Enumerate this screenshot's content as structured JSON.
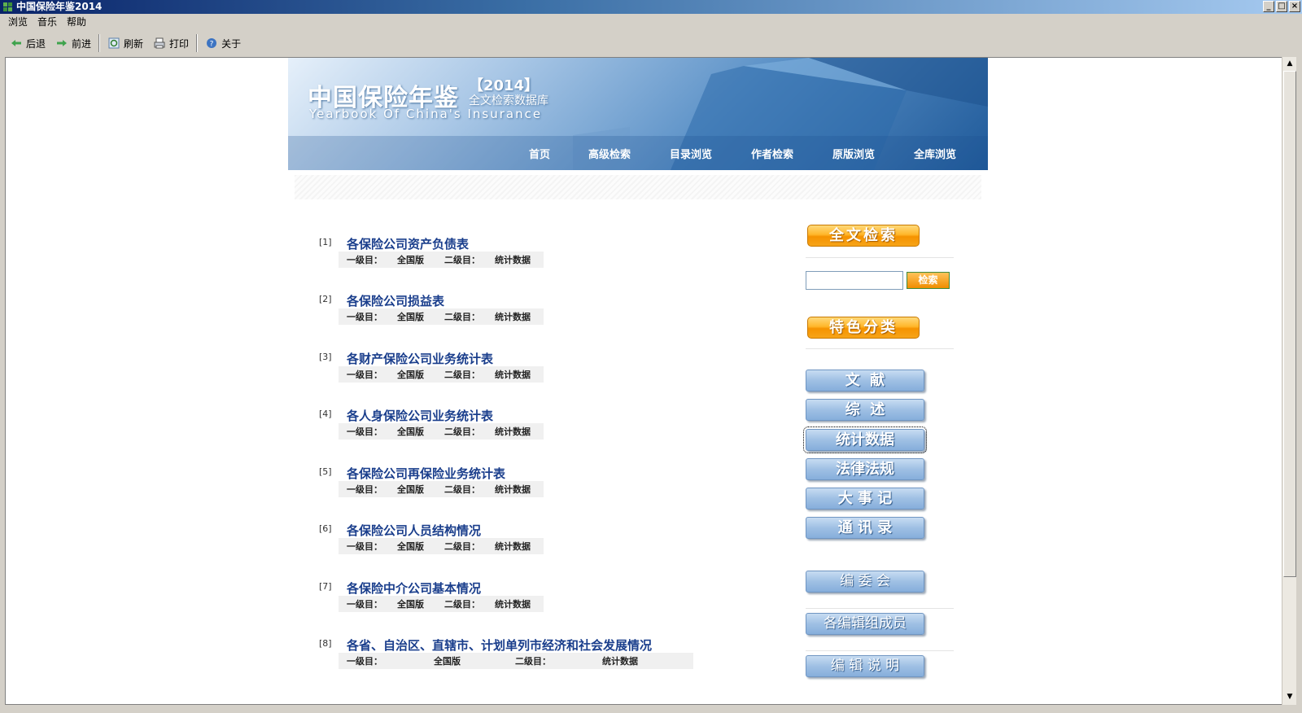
{
  "window": {
    "title": "中国保险年鉴2014",
    "controls": [
      "_",
      "□",
      "×"
    ]
  },
  "menu": [
    "浏览",
    "音乐",
    "帮助"
  ],
  "toolbar": {
    "back": "后退",
    "forward": "前进",
    "refresh": "刷新",
    "print": "打印",
    "about": "关于"
  },
  "banner": {
    "title": "中国保险年鉴",
    "year": "【2014】",
    "subtitle": "全文检索数据库",
    "english": "Yearbook Of China's Insurance",
    "nav": [
      "首页",
      "高级检索",
      "目录浏览",
      "作者检索",
      "原版浏览",
      "全库浏览"
    ]
  },
  "results": [
    {
      "num": "[1]",
      "title": "各保险公司资产负债表",
      "l1_label": "一级目：",
      "l1_value": "全国版",
      "l2_label": "二级目：",
      "l2_value": "统计数据"
    },
    {
      "num": "[2]",
      "title": "各保险公司损益表",
      "l1_label": "一级目：",
      "l1_value": "全国版",
      "l2_label": "二级目：",
      "l2_value": "统计数据"
    },
    {
      "num": "[3]",
      "title": "各财产保险公司业务统计表",
      "l1_label": "一级目：",
      "l1_value": "全国版",
      "l2_label": "二级目：",
      "l2_value": "统计数据"
    },
    {
      "num": "[4]",
      "title": "各人身保险公司业务统计表",
      "l1_label": "一级目：",
      "l1_value": "全国版",
      "l2_label": "二级目：",
      "l2_value": "统计数据"
    },
    {
      "num": "[5]",
      "title": "各保险公司再保险业务统计表",
      "l1_label": "一级目：",
      "l1_value": "全国版",
      "l2_label": "二级目：",
      "l2_value": "统计数据"
    },
    {
      "num": "[6]",
      "title": "各保险公司人员结构情况",
      "l1_label": "一级目：",
      "l1_value": "全国版",
      "l2_label": "二级目：",
      "l2_value": "统计数据"
    },
    {
      "num": "[7]",
      "title": "各保险中介公司基本情况",
      "l1_label": "一级目：",
      "l1_value": "全国版",
      "l2_label": "二级目：",
      "l2_value": "统计数据"
    },
    {
      "num": "[8]",
      "title": "各省、自治区、直辖市、计划单列市经济和社会发展情况",
      "l1_label": "一级目：",
      "l1_value": "全国版",
      "l2_label": "二级目：",
      "l2_value": "统计数据"
    }
  ],
  "sidebar": {
    "fulltext_header": "全文检索",
    "search_value": "",
    "search_button": "检索",
    "category_header": "特色分类",
    "categories": [
      "文  献",
      "综  述",
      "统计数据",
      "法律法规",
      "大 事 记",
      "通 讯 录"
    ],
    "extras": [
      "编 委 会",
      "各编辑组成员",
      "编 辑 说 明"
    ]
  }
}
